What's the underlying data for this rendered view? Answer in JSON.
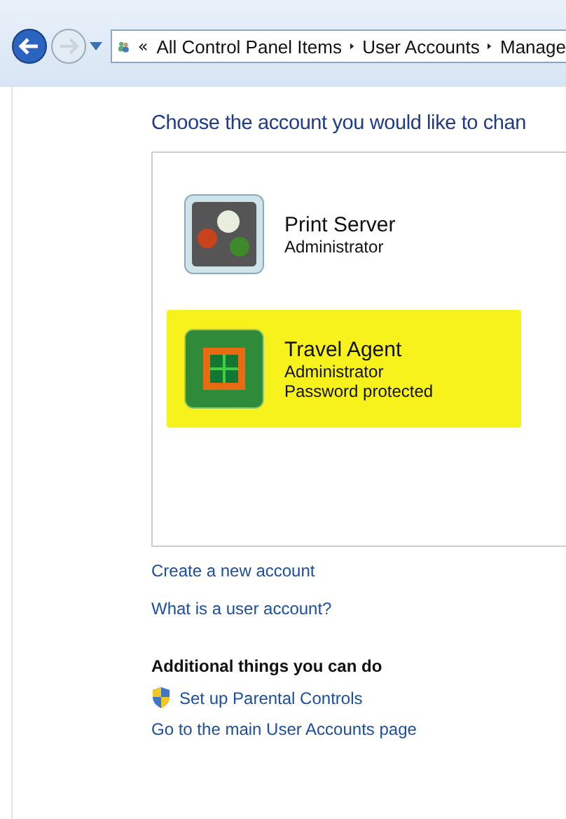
{
  "address_bar": {
    "overflow": "«",
    "crumbs": [
      "All Control Panel Items",
      "User Accounts",
      "Manage"
    ]
  },
  "heading": "Choose the account you would like to chan",
  "accounts": [
    {
      "name": "Print Server",
      "details": [
        "Administrator"
      ],
      "kind": "marbles",
      "selected": false
    },
    {
      "name": "Travel Agent",
      "details": [
        "Administrator",
        "Password protected"
      ],
      "kind": "window",
      "selected": true
    }
  ],
  "links": [
    "Create a new account",
    "What is a user account?"
  ],
  "additional": {
    "title": "Additional things you can do",
    "links": [
      {
        "text": "Set up Parental Controls",
        "kind": "shield"
      },
      {
        "text": "Go to the main User Accounts page",
        "kind": "plain"
      }
    ]
  }
}
